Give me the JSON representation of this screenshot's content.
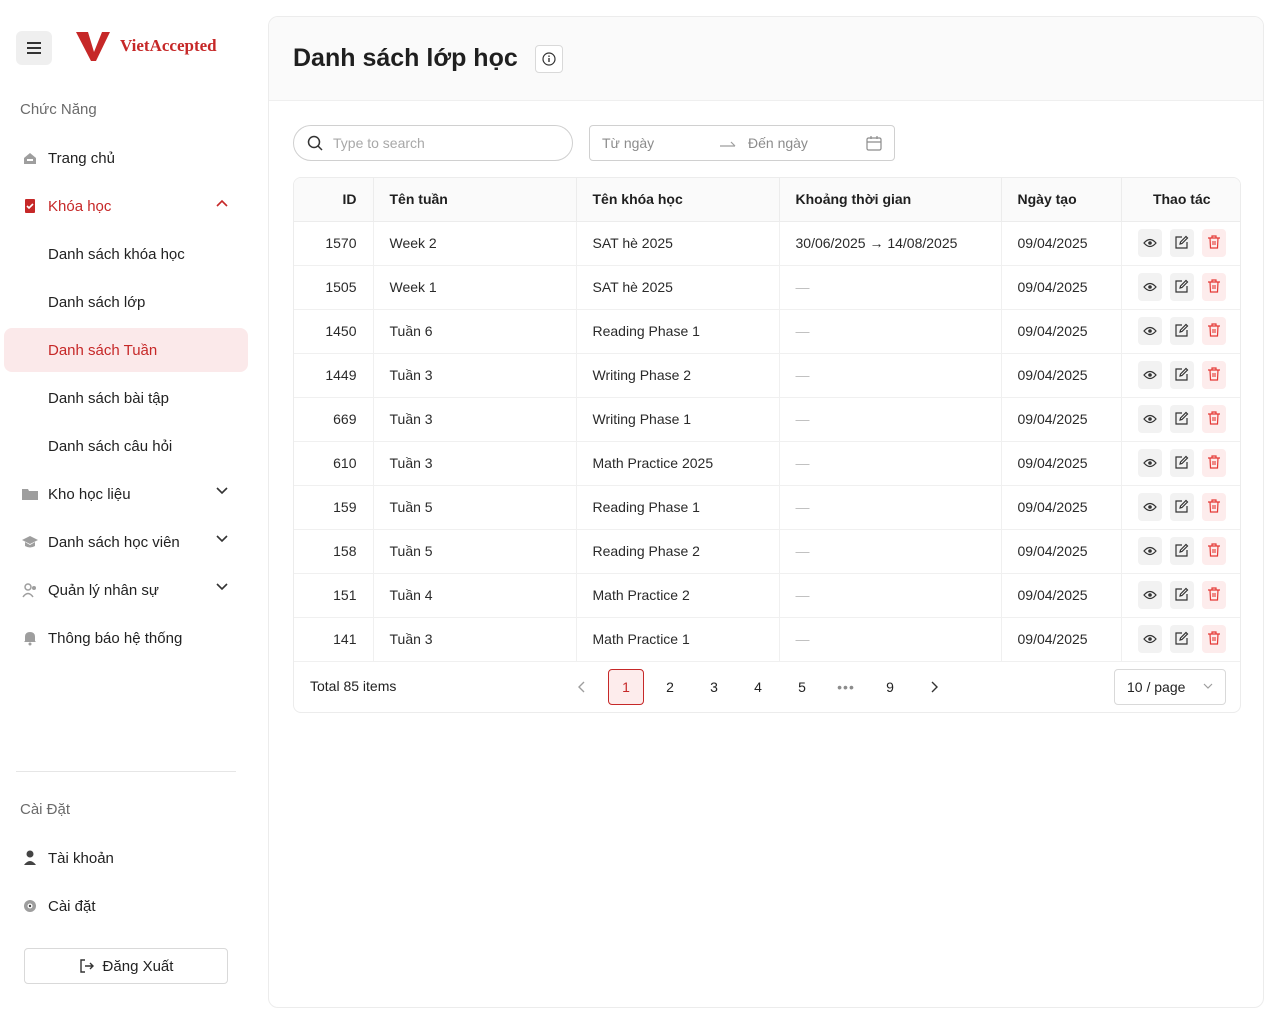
{
  "brand": {
    "name": "VietAccepted",
    "color": "#c62828"
  },
  "sidebar": {
    "features_title": "Chức Năng",
    "items": [
      {
        "label": "Trang chủ",
        "icon": "home-icon"
      },
      {
        "label": "Khóa học",
        "icon": "book-icon",
        "expanded": true
      },
      {
        "label": "Danh sách khóa học"
      },
      {
        "label": "Danh sách lớp"
      },
      {
        "label": "Danh sách Tuần",
        "active": true
      },
      {
        "label": "Danh sách bài tập"
      },
      {
        "label": "Danh sách câu hỏi"
      },
      {
        "label": "Kho học liệu",
        "icon": "folder-icon"
      },
      {
        "label": "Danh sách học viên",
        "icon": "graduation-cap-icon"
      },
      {
        "label": "Quản lý nhân sự",
        "icon": "users-icon"
      },
      {
        "label": "Thông báo hệ thống",
        "icon": "bell-icon"
      }
    ],
    "settings_title": "Cài Đặt",
    "account_label": "Tài khoản",
    "settings_label": "Cài đặt",
    "logout_label": "Đăng Xuất"
  },
  "page": {
    "title": "Danh sách lớp học",
    "search_placeholder": "Type to search",
    "date_from_placeholder": "Từ ngày",
    "date_to_placeholder": "Đến ngày"
  },
  "table": {
    "headers": {
      "id": "ID",
      "week": "Tên tuần",
      "course": "Tên khóa học",
      "period": "Khoảng thời gian",
      "created": "Ngày tạo",
      "actions": "Thao tác"
    },
    "rows": [
      {
        "id": "1570",
        "week": "Week 2",
        "course": "SAT hè 2025",
        "period": "30/06/2025 → 14/08/2025",
        "created": "09/04/2025"
      },
      {
        "id": "1505",
        "week": "Week 1",
        "course": "SAT hè 2025",
        "period": "—",
        "created": "09/04/2025"
      },
      {
        "id": "1450",
        "week": "Tuần 6",
        "course": "Reading Phase 1",
        "period": "—",
        "created": "09/04/2025"
      },
      {
        "id": "1449",
        "week": "Tuần 3",
        "course": "Writing Phase 2",
        "period": "—",
        "created": "09/04/2025"
      },
      {
        "id": "669",
        "week": "Tuần 3",
        "course": "Writing Phase 1",
        "period": "—",
        "created": "09/04/2025"
      },
      {
        "id": "610",
        "week": "Tuần 3",
        "course": "Math Practice 2025",
        "period": "—",
        "created": "09/04/2025"
      },
      {
        "id": "159",
        "week": "Tuần 5",
        "course": "Reading Phase 1",
        "period": "—",
        "created": "09/04/2025"
      },
      {
        "id": "158",
        "week": "Tuần 5",
        "course": "Reading Phase 2",
        "period": "—",
        "created": "09/04/2025"
      },
      {
        "id": "151",
        "week": "Tuần 4",
        "course": "Math Practice 2",
        "period": "—",
        "created": "09/04/2025"
      },
      {
        "id": "141",
        "week": "Tuần 3",
        "course": "Math Practice 1",
        "period": "—",
        "created": "09/04/2025"
      }
    ]
  },
  "pagination": {
    "total_label": "Total 85 items",
    "pages": [
      "1",
      "2",
      "3",
      "4",
      "5",
      "•••",
      "9"
    ],
    "current": "1",
    "per_page": "10 / page"
  }
}
